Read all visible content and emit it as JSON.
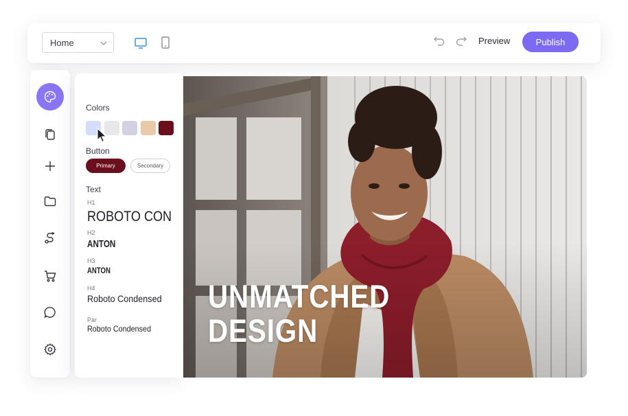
{
  "toolbar": {
    "page_select": {
      "value": "Home",
      "icon": "chevron-down-icon"
    },
    "device_buttons": [
      {
        "name": "desktop",
        "icon": "monitor-icon",
        "active": true
      },
      {
        "name": "mobile",
        "icon": "smartphone-icon",
        "active": false
      }
    ],
    "undo_icon": "undo-icon",
    "redo_icon": "redo-icon",
    "preview_label": "Preview",
    "publish_label": "Publish"
  },
  "sidebar": {
    "items": [
      {
        "name": "styles",
        "icon": "palette-icon",
        "active": true
      },
      {
        "name": "pages",
        "icon": "copy-icon",
        "active": false
      },
      {
        "name": "add",
        "icon": "plus-icon",
        "active": false
      },
      {
        "name": "files",
        "icon": "folder-icon",
        "active": false
      },
      {
        "name": "integrations",
        "icon": "route-icon",
        "active": false
      },
      {
        "name": "store",
        "icon": "cart-icon",
        "active": false
      },
      {
        "name": "chat",
        "icon": "chat-bubble-icon",
        "active": false
      },
      {
        "name": "settings",
        "icon": "gear-icon",
        "active": false
      }
    ]
  },
  "style_panel": {
    "colors_label": "Colors",
    "swatches": [
      "#d6dcfb",
      "#e8e8ea",
      "#d3d0e3",
      "#ebcaa8",
      "#6b0f1f"
    ],
    "button_label": "Button",
    "primary_label": "Primary",
    "secondary_label": "Secondary",
    "text_label": "Text",
    "fonts": [
      {
        "tag": "H1",
        "sample": "ROBOTO CON"
      },
      {
        "tag": "H2",
        "sample": "ANTON"
      },
      {
        "tag": "H3",
        "sample": "ANTON"
      },
      {
        "tag": "H4",
        "sample": "Roboto Condensed"
      },
      {
        "tag": "Par",
        "sample": "Roboto Condensed"
      }
    ]
  },
  "hero": {
    "title_line1": "UNMATCHED",
    "title_line2": "DESIGN"
  },
  "colors": {
    "accent": "#7c6bf2",
    "primary_button": "#6b0f1f"
  }
}
